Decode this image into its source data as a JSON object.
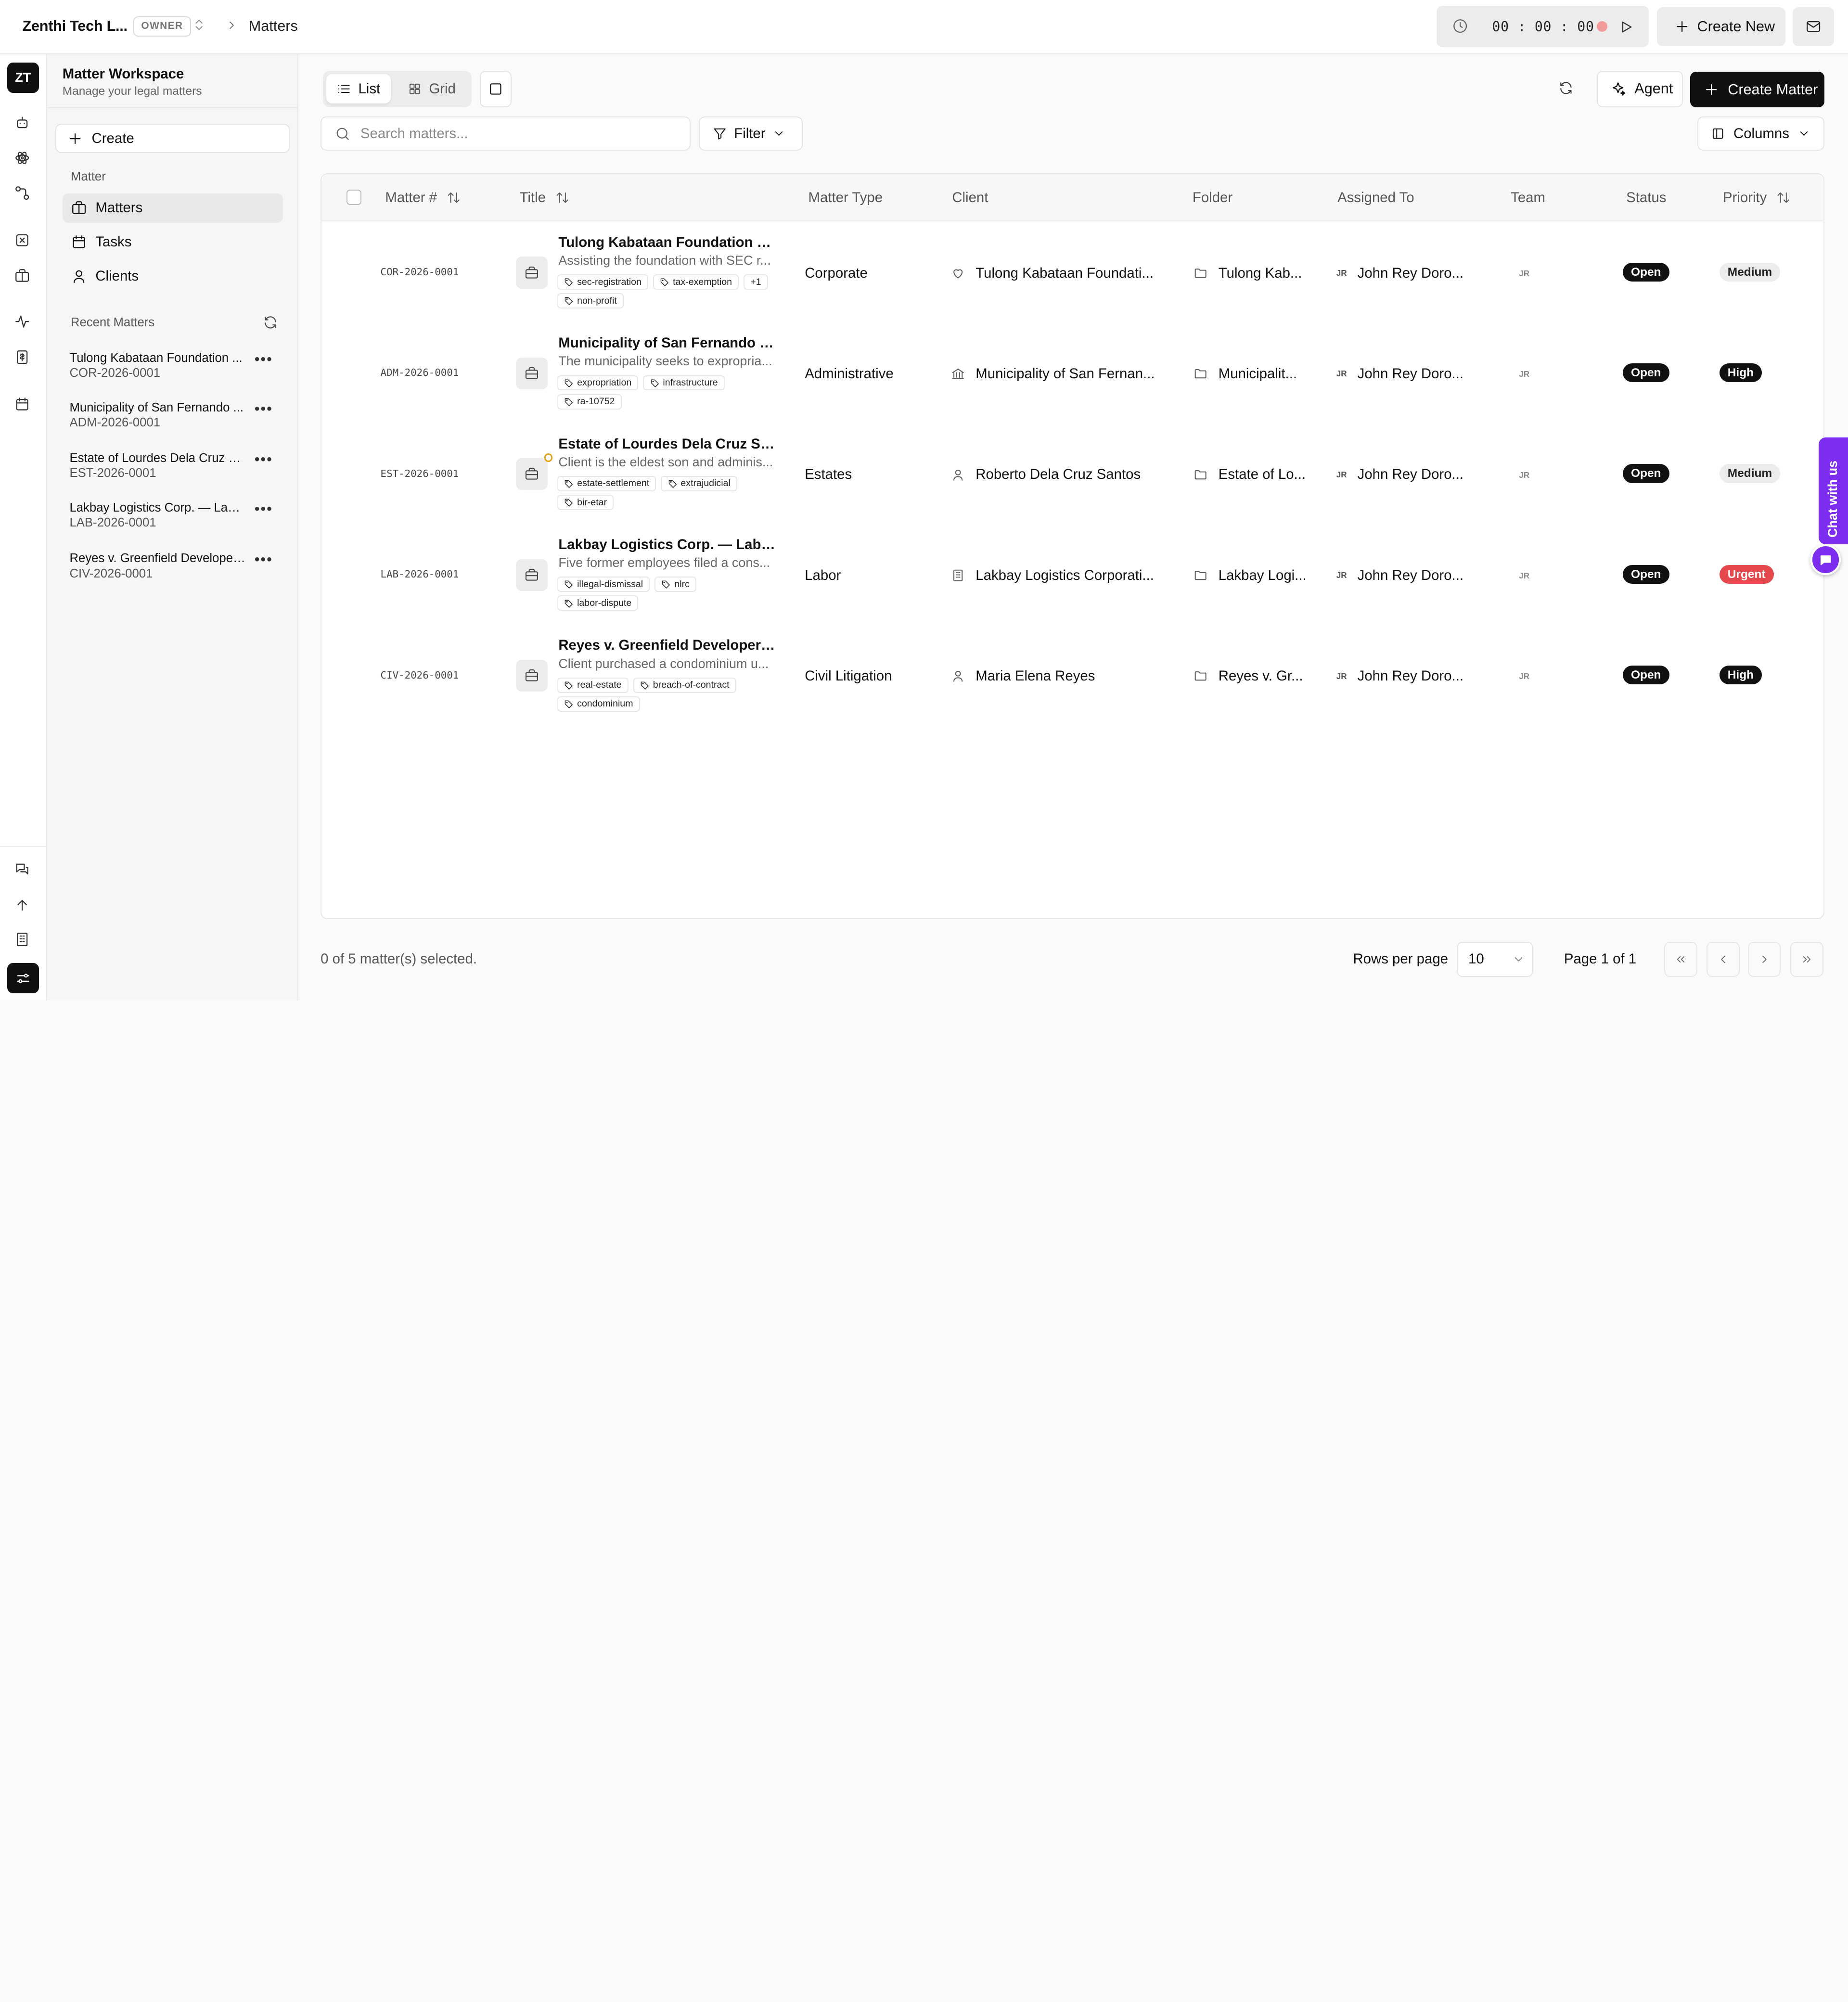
{
  "topbar": {
    "org": "Zenthi Tech L...",
    "role": "OWNER",
    "breadcrumb": "Matters",
    "timer": "00 : 00 : 00",
    "create_new": "Create New"
  },
  "rail": {
    "logo": "ZT"
  },
  "side": {
    "title": "Matter Workspace",
    "subtitle": "Manage your legal matters",
    "create": "Create",
    "group_label": "Matter",
    "nav": [
      {
        "label": "Matters",
        "icon": "briefcase-icon"
      },
      {
        "label": "Tasks",
        "icon": "calendar-icon"
      },
      {
        "label": "Clients",
        "icon": "user-icon"
      }
    ],
    "recent_label": "Recent Matters",
    "recent": [
      {
        "title": "Tulong Kabataan Foundation ...",
        "code": "COR-2026-0001"
      },
      {
        "title": "Municipality of San Fernando ...",
        "code": "ADM-2026-0001"
      },
      {
        "title": "Estate of Lourdes Dela Cruz Sa...",
        "code": "EST-2026-0001"
      },
      {
        "title": "Lakbay Logistics Corp. — Labo...",
        "code": "LAB-2026-0001"
      },
      {
        "title": "Reyes v. Greenfield Developer...",
        "code": "CIV-2026-0001"
      }
    ]
  },
  "toolbar": {
    "list": "List",
    "grid": "Grid",
    "agent": "Agent",
    "create_matter": "Create Matter",
    "search_placeholder": "Search matters...",
    "filter": "Filter",
    "columns": "Columns"
  },
  "table": {
    "headers": {
      "matter_no": "Matter #",
      "title": "Title",
      "matter_type": "Matter Type",
      "client": "Client",
      "folder": "Folder",
      "assigned_to": "Assigned To",
      "team": "Team",
      "status": "Status",
      "priority": "Priority"
    },
    "rows": [
      {
        "number": "COR-2026-0001",
        "title": "Tulong Kabataan Foundation — ...",
        "desc": "Assisting the foundation with SEC r...",
        "tags": [
          "sec-registration",
          "tax-exemption",
          "non-profit"
        ],
        "more": "+1",
        "type": "Corporate",
        "client": "Tulong Kabataan Foundati...",
        "client_icon": "heart-icon",
        "folder": "Tulong Kab...",
        "assignee_initials": "JR",
        "assignee": "John Rey Doro...",
        "team": "JR",
        "status": "Open",
        "priority": "Medium",
        "priority_level": "medium",
        "warn": false
      },
      {
        "number": "ADM-2026-0001",
        "title": "Municipality of San Fernando — ...",
        "desc": "The municipality seeks to expropria...",
        "tags": [
          "expropriation",
          "infrastructure",
          "ra-10752"
        ],
        "more": "",
        "type": "Administrative",
        "client": "Municipality of San Fernan...",
        "client_icon": "landmark-icon",
        "folder": "Municipalit...",
        "assignee_initials": "JR",
        "assignee": "John Rey Doro...",
        "team": "JR",
        "status": "Open",
        "priority": "High",
        "priority_level": "high",
        "warn": false
      },
      {
        "number": "EST-2026-0001",
        "title": "Estate of Lourdes Dela Cruz San...",
        "desc": "Client is the eldest son and adminis...",
        "tags": [
          "estate-settlement",
          "extrajudicial",
          "bir-etar"
        ],
        "more": "",
        "type": "Estates",
        "client": "Roberto Dela Cruz Santos",
        "client_icon": "user-icon",
        "folder": "Estate of Lo...",
        "assignee_initials": "JR",
        "assignee": "John Rey Doro...",
        "team": "JR",
        "status": "Open",
        "priority": "Medium",
        "priority_level": "medium",
        "warn": true
      },
      {
        "number": "LAB-2026-0001",
        "title": "Lakbay Logistics Corp. — Labor ...",
        "desc": "Five former employees filed a cons...",
        "tags": [
          "illegal-dismissal",
          "nlrc",
          "labor-dispute"
        ],
        "more": "",
        "type": "Labor",
        "client": "Lakbay Logistics Corporati...",
        "client_icon": "building-icon",
        "folder": "Lakbay Logi...",
        "assignee_initials": "JR",
        "assignee": "John Rey Doro...",
        "team": "JR",
        "status": "Open",
        "priority": "Urgent",
        "priority_level": "urgent",
        "warn": false
      },
      {
        "number": "CIV-2026-0001",
        "title": "Reyes v. Greenfield Developers ...",
        "desc": "Client purchased a condominium u...",
        "tags": [
          "real-estate",
          "breach-of-contract",
          "condominium"
        ],
        "more": "",
        "type": "Civil Litigation",
        "client": "Maria Elena Reyes",
        "client_icon": "user-icon",
        "folder": "Reyes v. Gr...",
        "assignee_initials": "JR",
        "assignee": "John Rey Doro...",
        "team": "JR",
        "status": "Open",
        "priority": "High",
        "priority_level": "high",
        "warn": false
      }
    ]
  },
  "footer": {
    "selected": "0 of 5 matter(s) selected.",
    "rows_per_page_label": "Rows per page",
    "rows_per_page": "10",
    "page": "Page 1 of 1"
  },
  "chat": {
    "label": "Chat with us",
    "accent": "#7c2df0"
  },
  "colors": {
    "urgent": "#e5484d",
    "dark": "#111111",
    "warn": "#e3a21a"
  }
}
